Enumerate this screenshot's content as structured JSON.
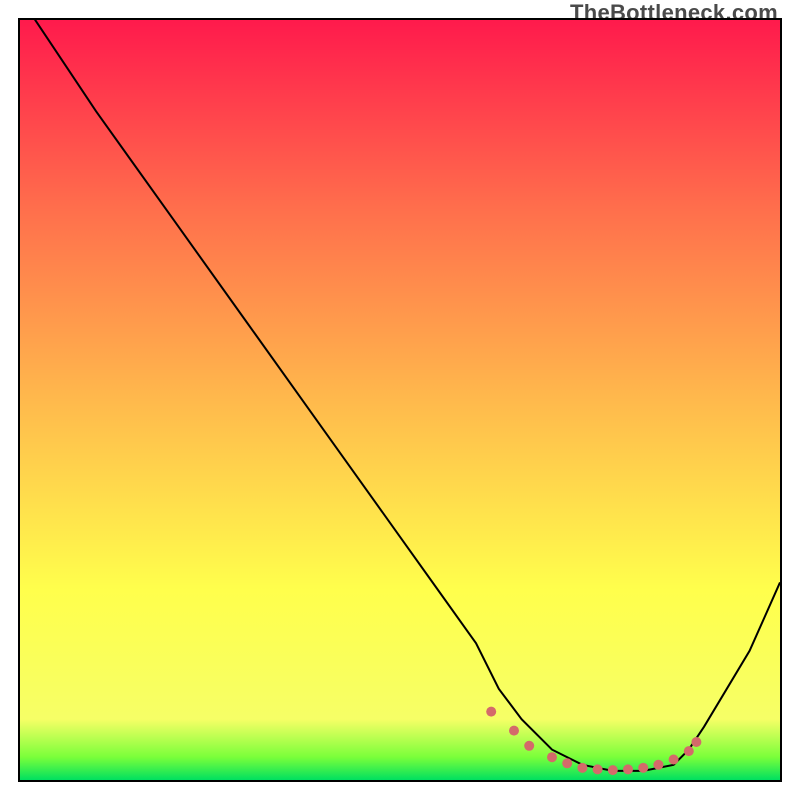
{
  "watermark": "TheBottleneck.com",
  "chart_data": {
    "type": "line",
    "title": "",
    "xlabel": "",
    "ylabel": "",
    "xlim": [
      0,
      100
    ],
    "ylim": [
      0,
      100
    ],
    "series": [
      {
        "name": "bottleneck-curve",
        "x": [
          0,
          2,
          6,
          10,
          20,
          30,
          40,
          50,
          55,
          60,
          63,
          66,
          70,
          74,
          78,
          82,
          86,
          88,
          90,
          93,
          96,
          100
        ],
        "values": [
          104,
          100,
          94,
          88,
          74,
          60,
          46,
          32,
          25,
          18,
          12,
          8,
          4,
          2,
          1.2,
          1.2,
          2,
          4,
          7,
          12,
          17,
          26
        ]
      }
    ],
    "markers": {
      "name": "highlight-dots",
      "color": "#d46a6a",
      "x": [
        62,
        65,
        67,
        70,
        72,
        74,
        76,
        78,
        80,
        82,
        84,
        86,
        88,
        89
      ],
      "values": [
        9,
        6.5,
        4.5,
        3,
        2.2,
        1.6,
        1.4,
        1.3,
        1.4,
        1.6,
        2.0,
        2.7,
        3.8,
        5.0
      ]
    }
  }
}
